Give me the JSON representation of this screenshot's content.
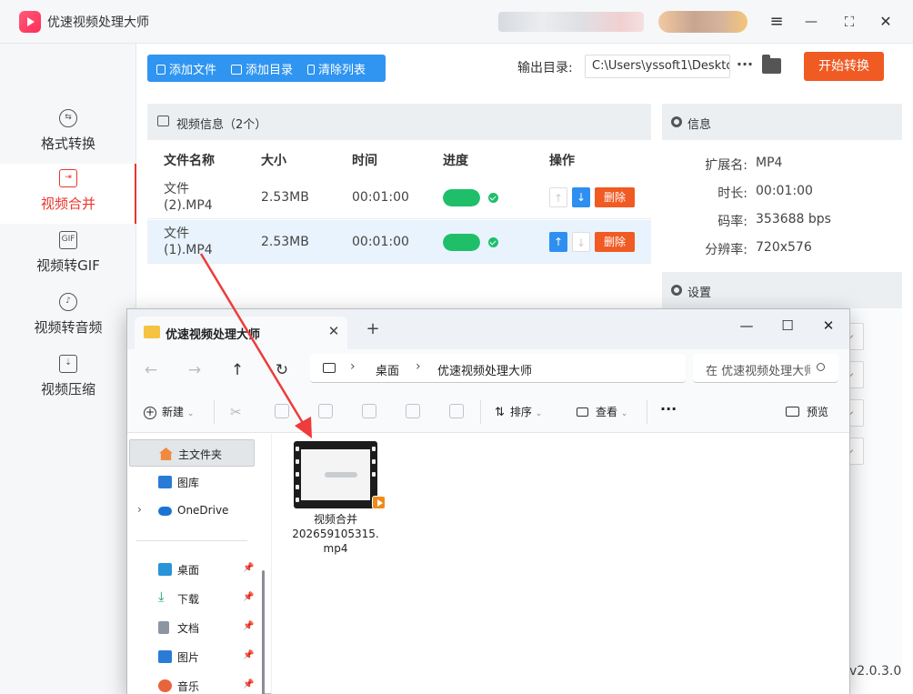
{
  "app": {
    "title": "优速视频处理大师",
    "version": "v2.0.3.0"
  },
  "window_controls": {
    "menu": "≡",
    "minimize": "—",
    "maximize": "⛶",
    "close": "✕"
  },
  "sidebar": {
    "items": [
      {
        "label": "格式转换",
        "icon": "convert-icon",
        "active": false
      },
      {
        "label": "视频合并",
        "icon": "merge-icon",
        "active": true
      },
      {
        "label": "视频转GIF",
        "icon": "gif-icon",
        "active": false
      },
      {
        "label": "视频转音频",
        "icon": "audio-icon",
        "active": false
      },
      {
        "label": "视频压缩",
        "icon": "compress-icon",
        "active": false
      }
    ]
  },
  "toolbar": {
    "add_file": "添加文件",
    "add_dir": "添加目录",
    "clear_list": "清除列表",
    "output_label": "输出目录:",
    "output_path": "C:\\Users\\yssoft1\\Deskto",
    "more": "···",
    "start": "开始转换"
  },
  "video_list": {
    "title": "视频信息（2个）",
    "columns": [
      "文件名称",
      "大小",
      "时间",
      "进度",
      "操作"
    ],
    "rows": [
      {
        "name": "文件 (2).MP4",
        "size": "2.53MB",
        "time": "00:01:00",
        "progress": 1.0,
        "up_enabled": false,
        "down_enabled": true,
        "delete": "删除",
        "selected": false
      },
      {
        "name": "文件 (1).MP4",
        "size": "2.53MB",
        "time": "00:01:00",
        "progress": 1.0,
        "up_enabled": true,
        "down_enabled": false,
        "delete": "删除",
        "selected": true
      }
    ]
  },
  "info": {
    "title": "信息",
    "fields": [
      {
        "key": "扩展名:",
        "value": "MP4"
      },
      {
        "key": "时长:",
        "value": "00:01:00"
      },
      {
        "key": "码率:",
        "value": "353688 bps"
      },
      {
        "key": "分辨率:",
        "value": "720x576"
      }
    ]
  },
  "settings": {
    "title": "设置"
  },
  "explorer": {
    "tab_title": "优速视频处理大师",
    "close": "✕",
    "new_tab": "+",
    "controls": {
      "minimize": "—",
      "maximize": "☐",
      "close": "✕"
    },
    "nav": {
      "back": "←",
      "forward": "→",
      "up": "↑",
      "refresh": "↻"
    },
    "breadcrumb": [
      "桌面",
      "优速视频处理大师"
    ],
    "search_placeholder": "在 优速视频处理大师 中搜索",
    "commands": {
      "new": "新建",
      "sort": "排序",
      "view": "查看",
      "more": "···",
      "preview": "预览"
    },
    "side_items": [
      {
        "label": "主文件夹",
        "icon": "home-icon",
        "selected": true,
        "pinned": false
      },
      {
        "label": "图库",
        "icon": "gallery-icon",
        "selected": false,
        "pinned": false
      },
      {
        "label": "OneDrive",
        "icon": "onedrive-icon",
        "selected": false,
        "pinned": false,
        "expandable": true
      },
      {
        "label": "桌面",
        "icon": "desktop-icon",
        "selected": false,
        "pinned": true
      },
      {
        "label": "下载",
        "icon": "download-icon",
        "selected": false,
        "pinned": true
      },
      {
        "label": "文档",
        "icon": "document-icon",
        "selected": false,
        "pinned": true
      },
      {
        "label": "图片",
        "icon": "pictures-icon",
        "selected": false,
        "pinned": true
      },
      {
        "label": "音乐",
        "icon": "music-icon",
        "selected": false,
        "pinned": true
      }
    ],
    "file": {
      "name_line1": "视频合并",
      "name_line2": "202659105315.",
      "name_line3": "mp4"
    }
  },
  "colors": {
    "accent": "#e9362b",
    "primary": "#2f95f0",
    "start": "#f05a23",
    "success": "#1fbf6a"
  }
}
